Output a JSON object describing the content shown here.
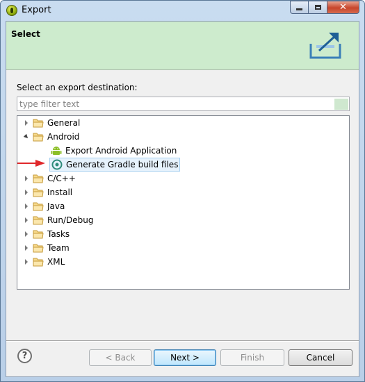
{
  "window": {
    "title": "Export"
  },
  "banner": {
    "title": "Select"
  },
  "prompt": "Select an export destination:",
  "filter": {
    "value": "",
    "placeholder": "type filter text"
  },
  "tree": {
    "items": [
      {
        "label": "General",
        "expanded": false
      },
      {
        "label": "Android",
        "expanded": true,
        "children": [
          {
            "label": "Export Android Application",
            "icon": "android-icon"
          },
          {
            "label": "Generate Gradle build files",
            "icon": "gradle-icon",
            "selected": true
          }
        ]
      },
      {
        "label": "C/C++",
        "expanded": false
      },
      {
        "label": "Install",
        "expanded": false
      },
      {
        "label": "Java",
        "expanded": false
      },
      {
        "label": "Run/Debug",
        "expanded": false
      },
      {
        "label": "Tasks",
        "expanded": false
      },
      {
        "label": "Team",
        "expanded": false
      },
      {
        "label": "XML",
        "expanded": false
      }
    ]
  },
  "buttons": {
    "back": "< Back",
    "next": "Next >",
    "finish": "Finish",
    "cancel": "Cancel",
    "help": "?"
  },
  "colors": {
    "banner": "#cdebcd",
    "arrow": "#e0282b",
    "close": "#c7452b"
  }
}
